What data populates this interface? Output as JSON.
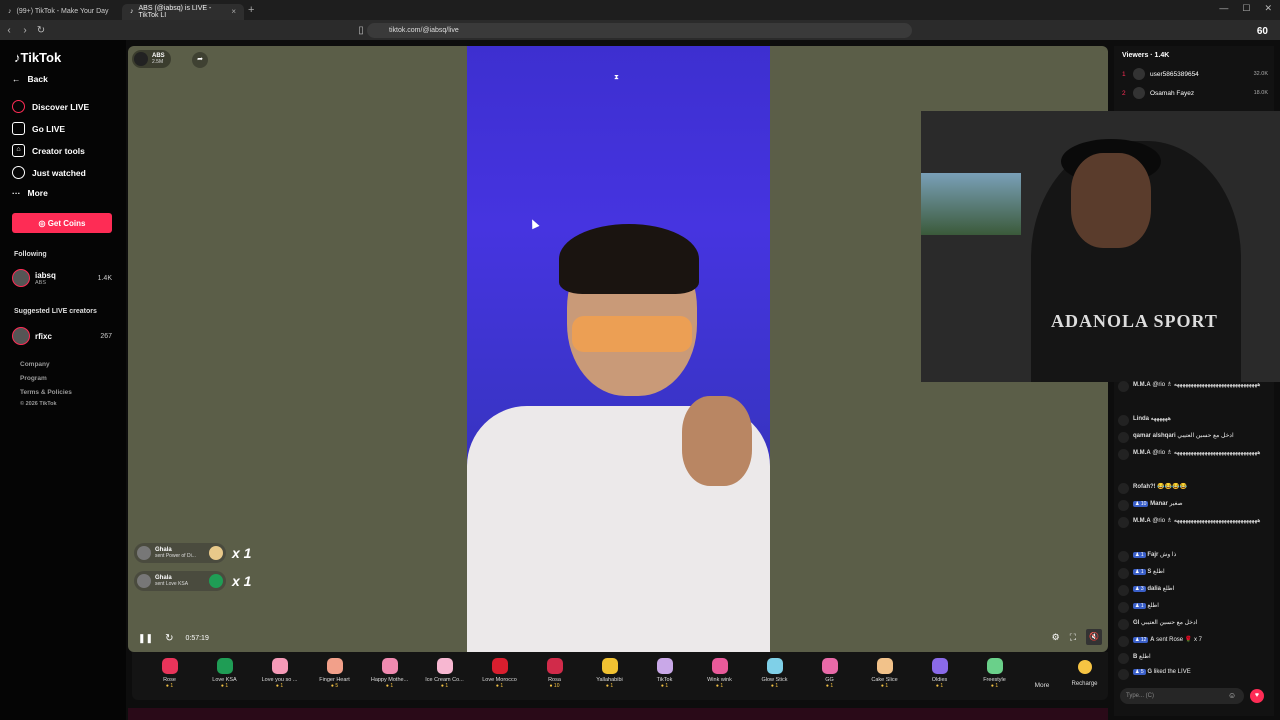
{
  "browser": {
    "tabs": [
      {
        "label": "(99+) TikTok - Make Your Day"
      },
      {
        "label": "ABS (@iabsq) is LIVE - TikTok LI"
      }
    ],
    "url": "tiktok.com/@iabsq/live",
    "overlay_text": "60"
  },
  "sidebar": {
    "logo": "TikTok",
    "back": "Back",
    "nav": [
      {
        "label": "Discover LIVE"
      },
      {
        "label": "Go LIVE"
      },
      {
        "label": "Creator tools"
      },
      {
        "label": "Just watched"
      },
      {
        "label": "More"
      }
    ],
    "get_coins": "Get Coins",
    "following_title": "Following",
    "following": {
      "name": "iabsq",
      "sub": "ABS",
      "count": "1.4K"
    },
    "suggested_title": "Suggested LIVE creators",
    "suggested": {
      "name": "rfixc",
      "sub": "",
      "count": "267"
    },
    "footer": [
      "Company",
      "Program",
      "Terms & Policies",
      "© 2026 TikTok"
    ]
  },
  "stage": {
    "host_name": "ABS",
    "host_likes": "2.5M",
    "time": "0:57:19",
    "gift_notes": [
      {
        "user": "Ghala",
        "text": "sent Power of Di...",
        "mult": "x 1"
      },
      {
        "user": "Ghala",
        "text": "sent Love KSA",
        "mult": "x 1"
      }
    ]
  },
  "gifts": [
    {
      "name": "Rose",
      "price": "1",
      "color": "#e8345a"
    },
    {
      "name": "Love KSA",
      "price": "1",
      "color": "#1f9d55"
    },
    {
      "name": "Love you so ...",
      "price": "1",
      "color": "#f59ab7"
    },
    {
      "name": "Finger Heart",
      "price": "5",
      "color": "#f2a08a"
    },
    {
      "name": "Happy Mothe...",
      "price": "1",
      "color": "#f08ab0"
    },
    {
      "name": "Ice Cream Co...",
      "price": "1",
      "color": "#f7b7d1"
    },
    {
      "name": "Love Morocco",
      "price": "1",
      "color": "#d91e2e"
    },
    {
      "name": "Rosa",
      "price": "10",
      "color": "#d12b4a"
    },
    {
      "name": "Yallahabibi",
      "price": "1",
      "color": "#f1c232"
    },
    {
      "name": "TikTok",
      "price": "1",
      "color": "#c9a8e8"
    },
    {
      "name": "Wink wink",
      "price": "1",
      "color": "#e85a9a"
    },
    {
      "name": "Glow Stick",
      "price": "1",
      "color": "#7fd0e8"
    },
    {
      "name": "GG",
      "price": "1",
      "color": "#e86aa8"
    },
    {
      "name": "Cake Slice",
      "price": "1",
      "color": "#f2c28a"
    },
    {
      "name": "Oldies",
      "price": "1",
      "color": "#8a6ae8"
    },
    {
      "name": "Freestyle",
      "price": "1",
      "color": "#6ad08a"
    }
  ],
  "gift_more": "More",
  "recharge": "Recharge",
  "viewers": {
    "title": "Viewers · 1.4K",
    "list": [
      {
        "rank": "1",
        "name": "user5865389654",
        "count": "32.0K"
      },
      {
        "rank": "2",
        "name": "Osamah Fayez",
        "count": "18.0K"
      }
    ]
  },
  "webcam_text": "ADANOLA SPORT",
  "chat": [
    {
      "user": "M.M.A",
      "msg": "@rio ♗ ههههههههههههههههههههههههههههههه"
    },
    {
      "user": "Linda",
      "msg": "ههههههه"
    },
    {
      "user": "qamar alshqari",
      "msg": "ادخل مع حسين العتيبي"
    },
    {
      "user": "M.M.A",
      "msg": "@rio ♗ ههههههههههههههههههههههههههههههه"
    },
    {
      "user": "Rofah?!",
      "msg": "😂😂😂😂"
    },
    {
      "user": "Manar",
      "msg": "صغير",
      "lvl": "10"
    },
    {
      "user": "M.M.A",
      "msg": "@rio ♗ ههههههههههههههههههههههههههههههه"
    },
    {
      "user": "Fajr",
      "msg": "ذا وش",
      "lvl": "1"
    },
    {
      "user": "S",
      "msg": "اطلع",
      "lvl": "1"
    },
    {
      "user": "dalia",
      "msg": "اطلع",
      "lvl": "3"
    },
    {
      "user": "",
      "msg": "اطلع",
      "lvl": "1"
    },
    {
      "user": "Gl",
      "msg": "ادخل مع حسين العتيبي"
    },
    {
      "user": "A",
      "msg": "sent Rose 🌹 x 7",
      "lvl": "12"
    },
    {
      "user": "B",
      "msg": "اطلع"
    },
    {
      "user": "G",
      "msg": "liked the LIVE",
      "lvl": "5"
    }
  ],
  "chat_placeholder": "Type... (C)"
}
